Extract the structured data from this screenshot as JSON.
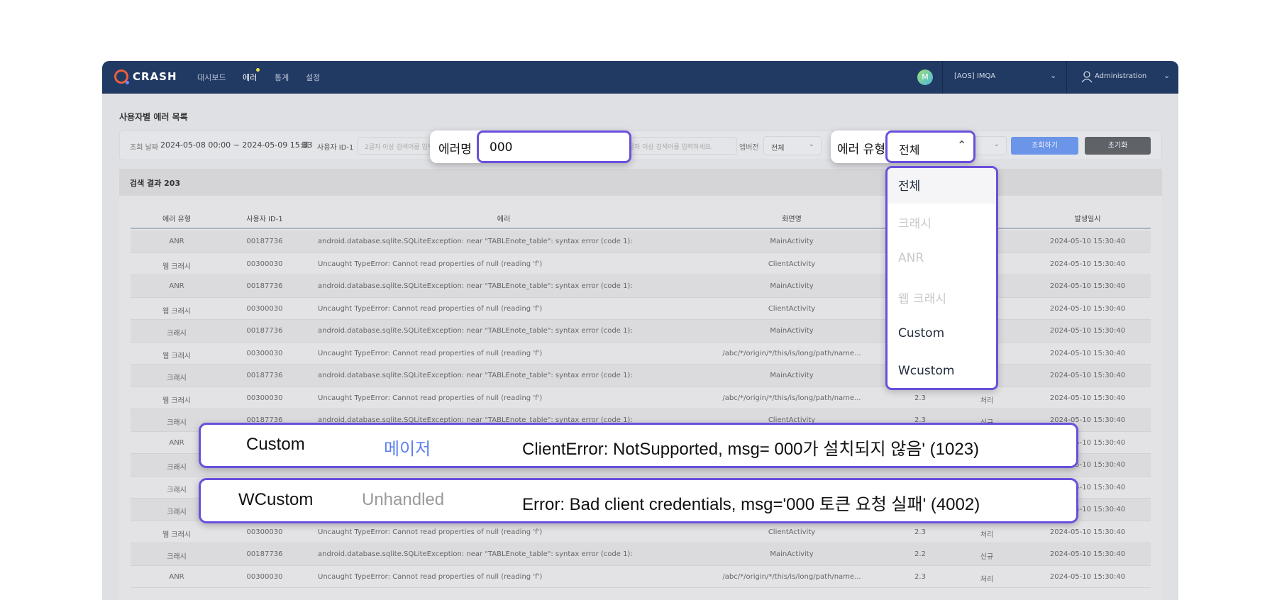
{
  "nav": {
    "logo": "CRASH",
    "items": [
      "대시보드",
      "에러",
      "통계",
      "설정"
    ],
    "avatar": "M",
    "project": "[AOS] IMQA",
    "user": "Administration"
  },
  "page": {
    "title": "사용자별 에러 목록"
  },
  "filter": {
    "date_label": "조회 날짜",
    "date_value": "2024-05-08 00:00 ~ 2024-05-09 15:33",
    "user_id_label": "사용자 ID-1",
    "placeholder": "2글자 이상 검색어를 입력하세요.",
    "app_version_label": "앱버전",
    "app_version_value": "전체",
    "search_button": "조회하기",
    "reset_button": "초기화"
  },
  "callout_error_name": {
    "label": "에러명",
    "value": "000"
  },
  "callout_error_type": {
    "label": "에러 유형",
    "value": "전체",
    "options": [
      {
        "label": "전체",
        "enabled": true,
        "selected": true
      },
      {
        "label": "크래시",
        "enabled": false
      },
      {
        "label": "ANR",
        "enabled": false
      },
      {
        "label": "웹 크래시",
        "enabled": false
      },
      {
        "label": "Custom",
        "enabled": true
      },
      {
        "label": "Wcustom",
        "enabled": true
      }
    ]
  },
  "results": {
    "title": "검색 결과 203",
    "columns": [
      "에러 유형",
      "사용자 ID-1",
      "에러",
      "화면명",
      "",
      "",
      "발생일시"
    ],
    "rows": [
      [
        "ANR",
        "00187736",
        "android.database.sqlite.SQLiteException: near \"TABLEnote_table\": syntax error (code 1):",
        "MainActivity",
        "",
        "",
        "2024-05-10 15:30:40"
      ],
      [
        "웹 크래시",
        "00300030",
        "Uncaught TypeError: Cannot read properties of null (reading 'f')",
        "ClientActivity",
        "",
        "",
        "2024-05-10 15:30:40"
      ],
      [
        "ANR",
        "00187736",
        "android.database.sqlite.SQLiteException: near \"TABLEnote_table\": syntax error (code 1):",
        "MainActivity",
        "",
        "",
        "2024-05-10 15:30:40"
      ],
      [
        "웹 크래시",
        "00300030",
        "Uncaught TypeError: Cannot read properties of null (reading 'f')",
        "ClientActivity",
        "",
        "",
        "2024-05-10 15:30:40"
      ],
      [
        "크래시",
        "00187736",
        "android.database.sqlite.SQLiteException: near \"TABLEnote_table\": syntax error (code 1):",
        "MainActivity",
        "",
        "",
        "2024-05-10 15:30:40"
      ],
      [
        "웹 크래시",
        "00300030",
        "Uncaught TypeError: Cannot read properties of null (reading 'f')",
        "/abc/*/origin/*/this/is/long/path/name...",
        "",
        "",
        "2024-05-10 15:30:40"
      ],
      [
        "크래시",
        "00187736",
        "android.database.sqlite.SQLiteException: near \"TABLEnote_table\": syntax error (code 1):",
        "MainActivity",
        "",
        "",
        "2024-05-10 15:30:40"
      ],
      [
        "웹 크래시",
        "00300030",
        "Uncaught TypeError: Cannot read properties of null (reading 'f')",
        "/abc/*/origin/*/this/is/long/path/name...",
        "2.3",
        "처리",
        "2024-05-10 15:30:40"
      ],
      [
        "크래시",
        "00187736",
        "android.database.sqlite.SQLiteException: near \"TABLEnote_table\": syntax error (code 1):",
        "ClientActivity",
        "2.3",
        "신규",
        "2024-05-10 15:30:40"
      ],
      [
        "ANR",
        "",
        "",
        "",
        "",
        "",
        "2024-05-10 15:30:40"
      ],
      [
        "크래시",
        "",
        "",
        "",
        "",
        "",
        "2024-05-10 15:30:40"
      ],
      [
        "크래시",
        "",
        "",
        "",
        "",
        "",
        "2024-05-10 15:30:40"
      ],
      [
        "크래시",
        "",
        "",
        "",
        "",
        "",
        "2024-05-10 15:30:40"
      ],
      [
        "웹 크래시",
        "00300030",
        "Uncaught TypeError: Cannot read properties of null (reading 'f')",
        "ClientActivity",
        "2.3",
        "처리",
        "2024-05-10 15:30:40"
      ],
      [
        "크래시",
        "00187736",
        "android.database.sqlite.SQLiteException: near \"TABLEnote_table\": syntax error (code 1):",
        "MainActivity",
        "2.2",
        "신규",
        "2024-05-10 15:30:40"
      ],
      [
        "ANR",
        "00300030",
        "Uncaught TypeError: Cannot read properties of null (reading 'f')",
        "/abc/*/origin/*/this/is/long/path/name...",
        "2.3",
        "처리",
        "2024-05-10 15:30:40"
      ]
    ]
  },
  "highlights": [
    {
      "type": "Custom",
      "level": "메이저",
      "level_color": "#5b7ff0",
      "message": "ClientError: NotSupported, msg= 000가 설치되지 않음' (1023)"
    },
    {
      "type": "WCustom",
      "level": "Unhandled",
      "level_color": "#9a9a9a",
      "message": "Error: Bad client credentials, msg='000 토큰 요청 실패' (4002)"
    }
  ],
  "colors": {
    "accent": "#6a4fdc",
    "nav": "#213a64",
    "search_button": "#6b95e8",
    "reset_button": "#5f6368"
  }
}
